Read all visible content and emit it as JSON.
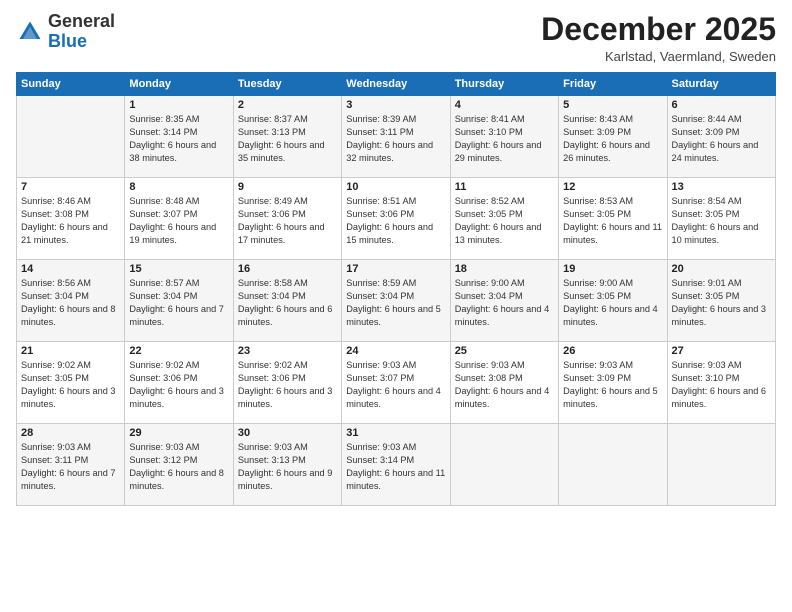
{
  "logo": {
    "general": "General",
    "blue": "Blue"
  },
  "header": {
    "month": "December 2025",
    "location": "Karlstad, Vaermland, Sweden"
  },
  "days_of_week": [
    "Sunday",
    "Monday",
    "Tuesday",
    "Wednesday",
    "Thursday",
    "Friday",
    "Saturday"
  ],
  "weeks": [
    [
      {
        "day": "",
        "sunrise": "",
        "sunset": "",
        "daylight": ""
      },
      {
        "day": "1",
        "sunrise": "Sunrise: 8:35 AM",
        "sunset": "Sunset: 3:14 PM",
        "daylight": "Daylight: 6 hours and 38 minutes."
      },
      {
        "day": "2",
        "sunrise": "Sunrise: 8:37 AM",
        "sunset": "Sunset: 3:13 PM",
        "daylight": "Daylight: 6 hours and 35 minutes."
      },
      {
        "day": "3",
        "sunrise": "Sunrise: 8:39 AM",
        "sunset": "Sunset: 3:11 PM",
        "daylight": "Daylight: 6 hours and 32 minutes."
      },
      {
        "day": "4",
        "sunrise": "Sunrise: 8:41 AM",
        "sunset": "Sunset: 3:10 PM",
        "daylight": "Daylight: 6 hours and 29 minutes."
      },
      {
        "day": "5",
        "sunrise": "Sunrise: 8:43 AM",
        "sunset": "Sunset: 3:09 PM",
        "daylight": "Daylight: 6 hours and 26 minutes."
      },
      {
        "day": "6",
        "sunrise": "Sunrise: 8:44 AM",
        "sunset": "Sunset: 3:09 PM",
        "daylight": "Daylight: 6 hours and 24 minutes."
      }
    ],
    [
      {
        "day": "7",
        "sunrise": "Sunrise: 8:46 AM",
        "sunset": "Sunset: 3:08 PM",
        "daylight": "Daylight: 6 hours and 21 minutes."
      },
      {
        "day": "8",
        "sunrise": "Sunrise: 8:48 AM",
        "sunset": "Sunset: 3:07 PM",
        "daylight": "Daylight: 6 hours and 19 minutes."
      },
      {
        "day": "9",
        "sunrise": "Sunrise: 8:49 AM",
        "sunset": "Sunset: 3:06 PM",
        "daylight": "Daylight: 6 hours and 17 minutes."
      },
      {
        "day": "10",
        "sunrise": "Sunrise: 8:51 AM",
        "sunset": "Sunset: 3:06 PM",
        "daylight": "Daylight: 6 hours and 15 minutes."
      },
      {
        "day": "11",
        "sunrise": "Sunrise: 8:52 AM",
        "sunset": "Sunset: 3:05 PM",
        "daylight": "Daylight: 6 hours and 13 minutes."
      },
      {
        "day": "12",
        "sunrise": "Sunrise: 8:53 AM",
        "sunset": "Sunset: 3:05 PM",
        "daylight": "Daylight: 6 hours and 11 minutes."
      },
      {
        "day": "13",
        "sunrise": "Sunrise: 8:54 AM",
        "sunset": "Sunset: 3:05 PM",
        "daylight": "Daylight: 6 hours and 10 minutes."
      }
    ],
    [
      {
        "day": "14",
        "sunrise": "Sunrise: 8:56 AM",
        "sunset": "Sunset: 3:04 PM",
        "daylight": "Daylight: 6 hours and 8 minutes."
      },
      {
        "day": "15",
        "sunrise": "Sunrise: 8:57 AM",
        "sunset": "Sunset: 3:04 PM",
        "daylight": "Daylight: 6 hours and 7 minutes."
      },
      {
        "day": "16",
        "sunrise": "Sunrise: 8:58 AM",
        "sunset": "Sunset: 3:04 PM",
        "daylight": "Daylight: 6 hours and 6 minutes."
      },
      {
        "day": "17",
        "sunrise": "Sunrise: 8:59 AM",
        "sunset": "Sunset: 3:04 PM",
        "daylight": "Daylight: 6 hours and 5 minutes."
      },
      {
        "day": "18",
        "sunrise": "Sunrise: 9:00 AM",
        "sunset": "Sunset: 3:04 PM",
        "daylight": "Daylight: 6 hours and 4 minutes."
      },
      {
        "day": "19",
        "sunrise": "Sunrise: 9:00 AM",
        "sunset": "Sunset: 3:05 PM",
        "daylight": "Daylight: 6 hours and 4 minutes."
      },
      {
        "day": "20",
        "sunrise": "Sunrise: 9:01 AM",
        "sunset": "Sunset: 3:05 PM",
        "daylight": "Daylight: 6 hours and 3 minutes."
      }
    ],
    [
      {
        "day": "21",
        "sunrise": "Sunrise: 9:02 AM",
        "sunset": "Sunset: 3:05 PM",
        "daylight": "Daylight: 6 hours and 3 minutes."
      },
      {
        "day": "22",
        "sunrise": "Sunrise: 9:02 AM",
        "sunset": "Sunset: 3:06 PM",
        "daylight": "Daylight: 6 hours and 3 minutes."
      },
      {
        "day": "23",
        "sunrise": "Sunrise: 9:02 AM",
        "sunset": "Sunset: 3:06 PM",
        "daylight": "Daylight: 6 hours and 3 minutes."
      },
      {
        "day": "24",
        "sunrise": "Sunrise: 9:03 AM",
        "sunset": "Sunset: 3:07 PM",
        "daylight": "Daylight: 6 hours and 4 minutes."
      },
      {
        "day": "25",
        "sunrise": "Sunrise: 9:03 AM",
        "sunset": "Sunset: 3:08 PM",
        "daylight": "Daylight: 6 hours and 4 minutes."
      },
      {
        "day": "26",
        "sunrise": "Sunrise: 9:03 AM",
        "sunset": "Sunset: 3:09 PM",
        "daylight": "Daylight: 6 hours and 5 minutes."
      },
      {
        "day": "27",
        "sunrise": "Sunrise: 9:03 AM",
        "sunset": "Sunset: 3:10 PM",
        "daylight": "Daylight: 6 hours and 6 minutes."
      }
    ],
    [
      {
        "day": "28",
        "sunrise": "Sunrise: 9:03 AM",
        "sunset": "Sunset: 3:11 PM",
        "daylight": "Daylight: 6 hours and 7 minutes."
      },
      {
        "day": "29",
        "sunrise": "Sunrise: 9:03 AM",
        "sunset": "Sunset: 3:12 PM",
        "daylight": "Daylight: 6 hours and 8 minutes."
      },
      {
        "day": "30",
        "sunrise": "Sunrise: 9:03 AM",
        "sunset": "Sunset: 3:13 PM",
        "daylight": "Daylight: 6 hours and 9 minutes."
      },
      {
        "day": "31",
        "sunrise": "Sunrise: 9:03 AM",
        "sunset": "Sunset: 3:14 PM",
        "daylight": "Daylight: 6 hours and 11 minutes."
      },
      {
        "day": "",
        "sunrise": "",
        "sunset": "",
        "daylight": ""
      },
      {
        "day": "",
        "sunrise": "",
        "sunset": "",
        "daylight": ""
      },
      {
        "day": "",
        "sunrise": "",
        "sunset": "",
        "daylight": ""
      }
    ]
  ]
}
